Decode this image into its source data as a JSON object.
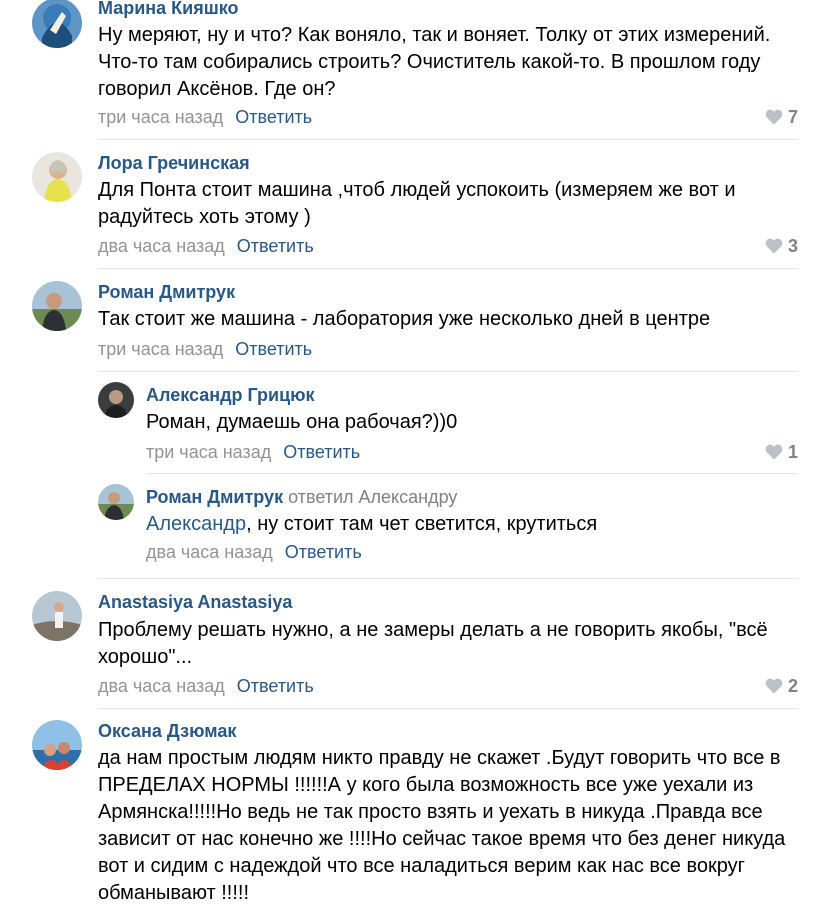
{
  "reply_label": "Ответить",
  "comments": [
    {
      "author": "Марина Кияшко",
      "text": [
        "Ну меряют, ну и что? Как воняло, так и воняет. Толку от этих измерений.",
        "Что-то там собирались строить? Очиститель какой-то. В прошлом году",
        "говорил Аксёнов. Где он?"
      ],
      "time": "три часа назад",
      "likes": "7"
    },
    {
      "author": "Лора Гречинская",
      "text": [
        "Для Понта стоит машина ,чтоб людей успокоить (измеряем же вот и",
        "радуйтесь хоть этому )"
      ],
      "time": "два часа назад",
      "likes": "3"
    },
    {
      "author": "Роман Дмитрук",
      "text": [
        "Так стоит же машина - лаборатория уже несколько дней в центре"
      ],
      "time": "три часа назад",
      "likes": ""
    },
    {
      "author": "Александр Грицюк",
      "text": [
        "Роман, думаешь она рабочая?))0"
      ],
      "time": "три часа назад",
      "likes": "1"
    },
    {
      "author": "Роман Дмитрук",
      "replied_to": "ответил Александру",
      "mention": "Александр",
      "text_rest": ", ну стоит там чет светится, крутиться",
      "time": "два часа назад",
      "likes": ""
    },
    {
      "author": "Anastasiya Anastasiya",
      "text": [
        "Проблему решать нужно, а не замеры делать а не говорить якобы, \"всё",
        "хорошо\"..."
      ],
      "time": "два часа назад",
      "likes": "2"
    },
    {
      "author": "Оксана Дзюмак",
      "text": [
        "да нам простым людям никто правду не скажет .Будут говорить что все в",
        "ПРЕДЕЛАХ НОРМЫ !!!!!!А у кого была возможность все уже уехали из",
        "Армянска!!!!!Но ведь не так просто взять и уехать в никуда .Правда все",
        "зависит от нас конечно же !!!!Но сейчас такое время что без денег никуда",
        "вот и сидим с надеждой что все наладиться верим как нас все вокруг",
        "обманывают !!!!!"
      ],
      "time": "",
      "likes": ""
    }
  ],
  "icons": {
    "avatar": "user-avatar",
    "like": "heart-icon"
  },
  "colors": {
    "author": "#2a5885",
    "meta": "#939393",
    "like": "#828282",
    "separator": "#e3e4e8"
  }
}
